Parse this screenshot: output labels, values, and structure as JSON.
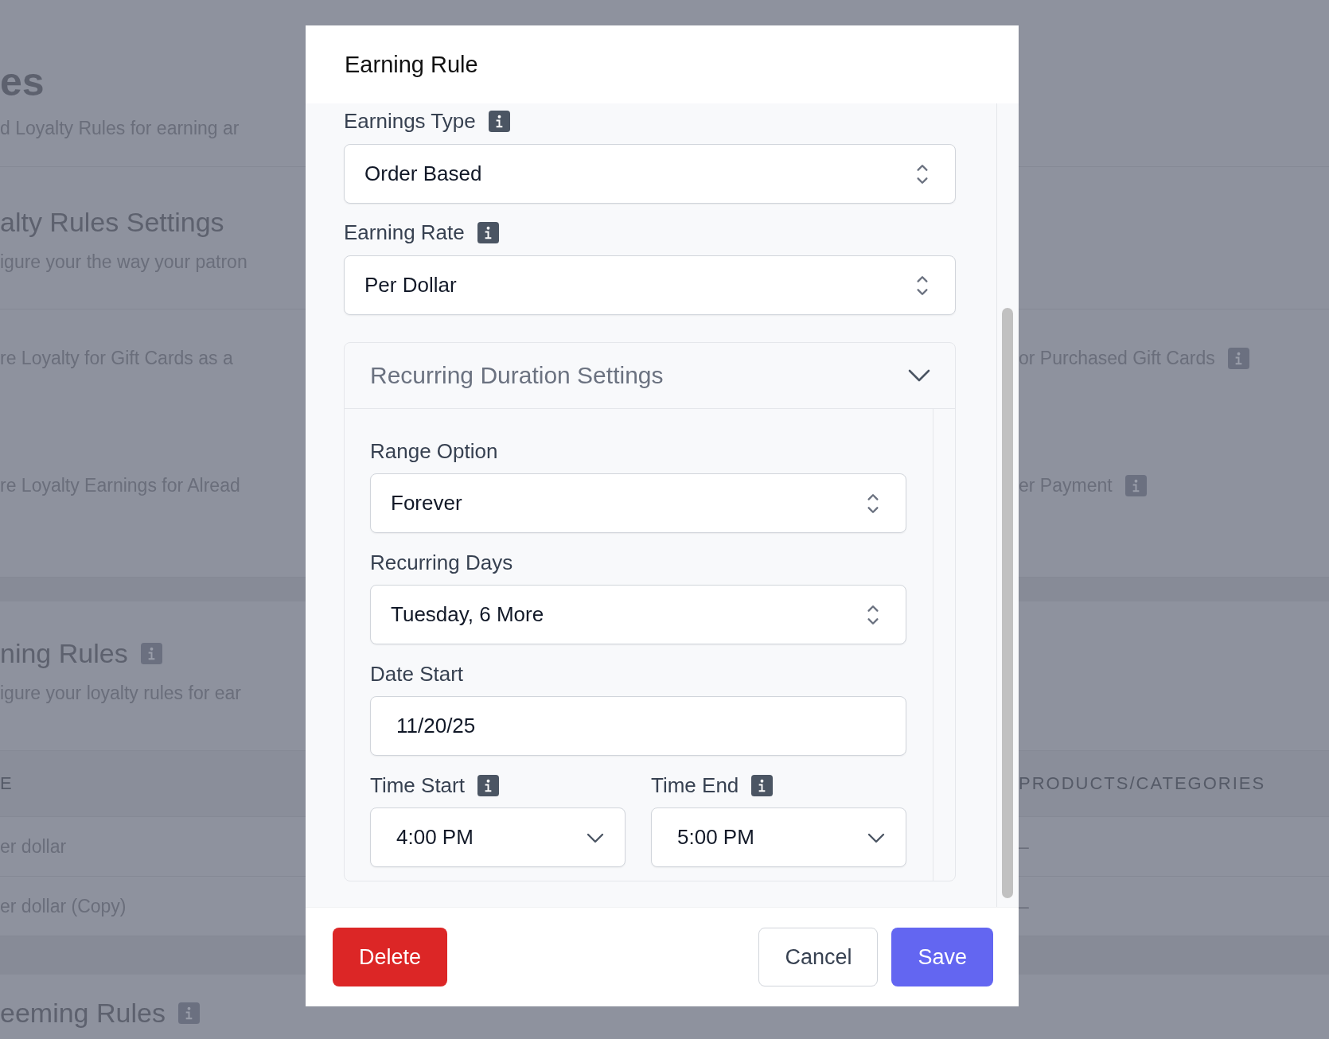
{
  "background": {
    "title": "es",
    "subtitle": "d Loyalty Rules for earning ar",
    "settings": {
      "title": "alty Rules Settings",
      "description": "igure your the way your patron",
      "options": [
        {
          "left": "re Loyalty for Gift Cards as a",
          "right": "or Purchased Gift Cards",
          "info": true
        },
        {
          "left": "re Loyalty Earnings for Alread",
          "right": "er Payment",
          "info": true
        }
      ]
    },
    "earning_rules": {
      "title": "ning Rules",
      "info": true,
      "description": "igure your loyalty rules for ear",
      "columns": [
        "E",
        "PRODUCTS/CATEGORIES"
      ],
      "rows": [
        [
          "er dollar",
          "–"
        ],
        [
          "er dollar (Copy)",
          "–"
        ]
      ]
    },
    "redeeming_rules": {
      "title": "eeming Rules",
      "info": true
    }
  },
  "modal": {
    "title": "Earning Rule",
    "fields": [
      {
        "label": "Earnings Type",
        "info": true,
        "value": "Order Based"
      },
      {
        "label": "Earning Rate",
        "info": true,
        "value": "Per Dollar"
      }
    ],
    "accordion": {
      "title": "Recurring Duration Settings",
      "expanded": true,
      "fields": [
        {
          "kind": "select",
          "label": "Range Option",
          "value": "Forever"
        },
        {
          "kind": "select",
          "label": "Recurring Days",
          "value": "Tuesday, 6 More"
        },
        {
          "kind": "date",
          "label": "Date Start",
          "value": "11/20/25"
        }
      ],
      "times": [
        {
          "label": "Time Start",
          "info": true,
          "value": "4:00 PM"
        },
        {
          "label": "Time End",
          "info": true,
          "value": "5:00 PM"
        }
      ]
    },
    "buttons": [
      {
        "label": "Delete",
        "kind": "danger"
      },
      {
        "label": "Cancel",
        "kind": "secondary"
      },
      {
        "label": "Save",
        "kind": "primary"
      }
    ]
  }
}
